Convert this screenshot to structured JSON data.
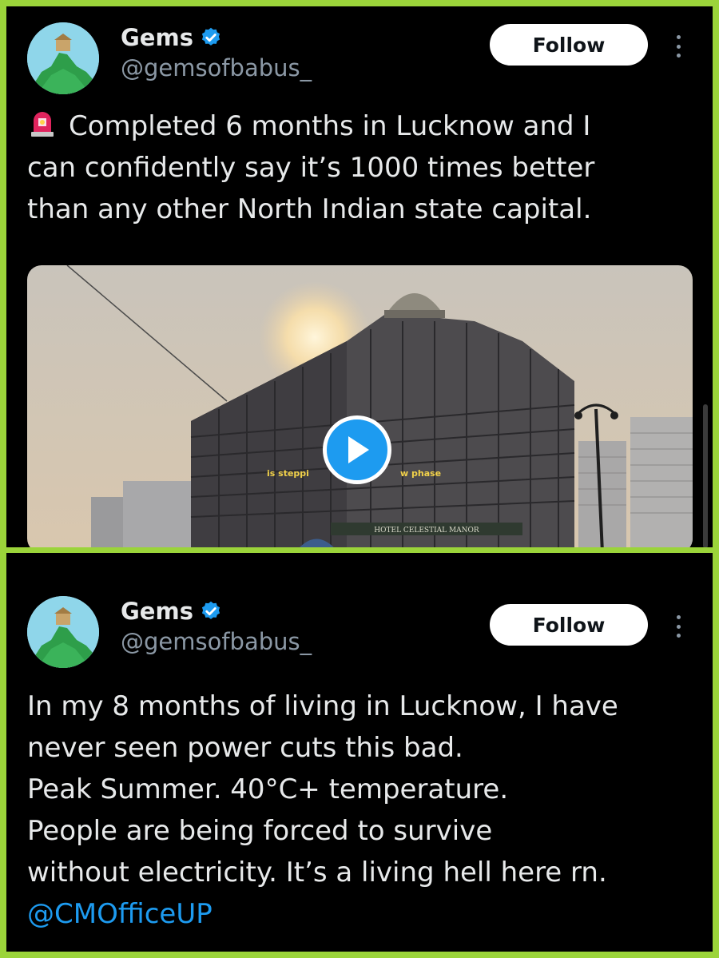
{
  "tweets": [
    {
      "author": {
        "name": "Gems",
        "handle": "@gemsofbabus_",
        "verified": true
      },
      "follow_label": "Follow",
      "text_lines": [
        "Completed 6 months in Lucknow and I",
        "can confidently say it’s 1000 times better",
        "than any other North Indian state capital."
      ],
      "leading_emoji": "police-siren-icon",
      "media": {
        "type": "video",
        "caption_left": "is steppi",
        "caption_right": "w phase",
        "sign_text": "HOTEL CELESTIAL MANOR"
      }
    },
    {
      "author": {
        "name": "Gems",
        "handle": "@gemsofbabus_",
        "verified": true
      },
      "follow_label": "Follow",
      "text_lines": [
        "In my 8 months of living in Lucknow, I have",
        "never seen power cuts this bad.",
        "Peak Summer. 40°C+ temperature.",
        "People are being forced to survive",
        "without electricity. It’s a living hell here rn."
      ],
      "mention": "@CMOfficeUP"
    }
  ],
  "colors": {
    "frame": "#9bd43a",
    "background": "#000000",
    "text": "#e7e9ea",
    "secondary_text": "#8b98a5",
    "accent": "#1d9bf0"
  }
}
